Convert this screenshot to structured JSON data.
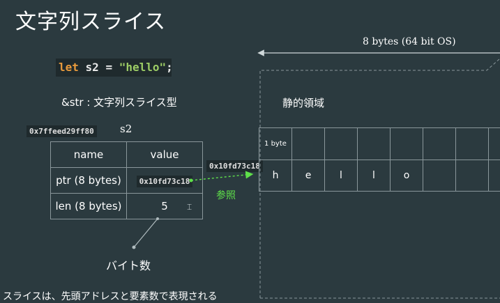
{
  "title": "文字列スライス",
  "code": {
    "keyword": "let",
    "variable": "s2",
    "operator": "=",
    "string": "\"hello\"",
    "terminator": ";"
  },
  "type_label": "&str : 文字列スライス型",
  "stack": {
    "address": "0x7ffeed29ff80",
    "variable_name": "s2",
    "headers": [
      "name",
      "value"
    ],
    "rows": [
      {
        "name": "ptr (8 bytes)",
        "value": "0x10fd73c18"
      },
      {
        "name": "len (8 bytes)",
        "value": "5"
      }
    ]
  },
  "pointer_target_address": "0x10fd73c18",
  "reference_label": "参照",
  "bytes_annotation": "バイト数",
  "word_size_label": "8 bytes (64 bit OS)",
  "static_area_label": "静的領域",
  "memory": {
    "unit_label": "1 byte",
    "cells": [
      "h",
      "e",
      "l",
      "l",
      "o",
      "",
      "",
      ""
    ]
  },
  "footer_note": "スライスは、先頭アドレスと要素数で表現される",
  "colors": {
    "background": "#2b3a3f",
    "reference_arrow": "#5fe04a",
    "border": "#8a979b",
    "keyword": "#e89a3c",
    "string": "#9ccc65"
  }
}
